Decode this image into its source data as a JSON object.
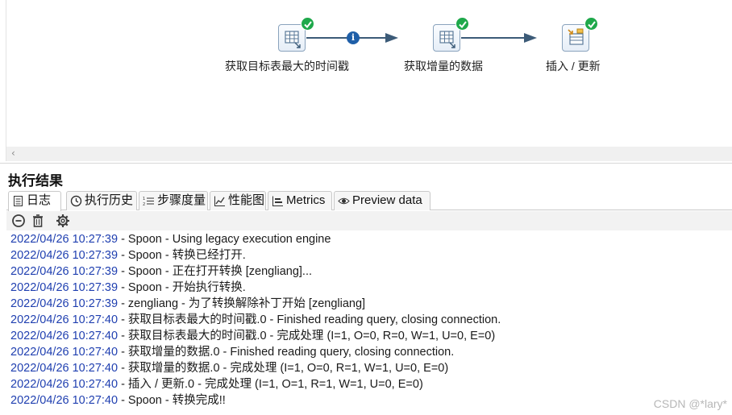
{
  "canvas": {
    "steps": [
      {
        "label": "获取目标表最大的时间戳",
        "icon": "table-input-icon",
        "status": "success"
      },
      {
        "label": "获取增量的数据",
        "icon": "table-input-icon",
        "status": "success"
      },
      {
        "label": "插入 / 更新",
        "icon": "insert-update-icon",
        "status": "success"
      }
    ],
    "hop_info_badge": "i"
  },
  "results": {
    "title": "执行结果",
    "tabs": [
      {
        "label": "日志",
        "icon": "log-icon",
        "active": true
      },
      {
        "label": "执行历史",
        "icon": "history-icon"
      },
      {
        "label": "步骤度量",
        "icon": "step-metrics-icon"
      },
      {
        "label": "性能图",
        "icon": "performance-graph-icon"
      },
      {
        "label": "Metrics",
        "icon": "metrics-icon"
      },
      {
        "label": "Preview data",
        "icon": "preview-eye-icon"
      }
    ],
    "toolbar": [
      "stop-icon",
      "trash-icon",
      "settings-gear-icon"
    ],
    "log": [
      {
        "ts": "2022/04/26 10:27:39",
        "msg": " - Spoon - Using legacy execution engine"
      },
      {
        "ts": "2022/04/26 10:27:39",
        "msg": " - Spoon - 转换已经打开."
      },
      {
        "ts": "2022/04/26 10:27:39",
        "msg": " - Spoon - 正在打开转换 [zengliang]..."
      },
      {
        "ts": "2022/04/26 10:27:39",
        "msg": " - Spoon - 开始执行转换."
      },
      {
        "ts": "2022/04/26 10:27:39",
        "msg": " - zengliang - 为了转换解除补丁开始  [zengliang]"
      },
      {
        "ts": "2022/04/26 10:27:40",
        "msg": " - 获取目标表最大的时间戳.0 - Finished reading query, closing connection."
      },
      {
        "ts": "2022/04/26 10:27:40",
        "msg": " - 获取目标表最大的时间戳.0 - 完成处理 (I=1, O=0, R=0, W=1, U=0, E=0)"
      },
      {
        "ts": "2022/04/26 10:27:40",
        "msg": " - 获取增量的数据.0 - Finished reading query, closing connection."
      },
      {
        "ts": "2022/04/26 10:27:40",
        "msg": " - 获取增量的数据.0 - 完成处理 (I=1, O=0, R=1, W=1, U=0, E=0)"
      },
      {
        "ts": "2022/04/26 10:27:40",
        "msg": " - 插入 / 更新.0 - 完成处理 (I=1, O=1, R=1, W=1, U=0, E=0)"
      },
      {
        "ts": "2022/04/26 10:27:40",
        "msg": " - Spoon - 转换完成!!"
      }
    ]
  },
  "watermark": "CSDN @*lary*"
}
